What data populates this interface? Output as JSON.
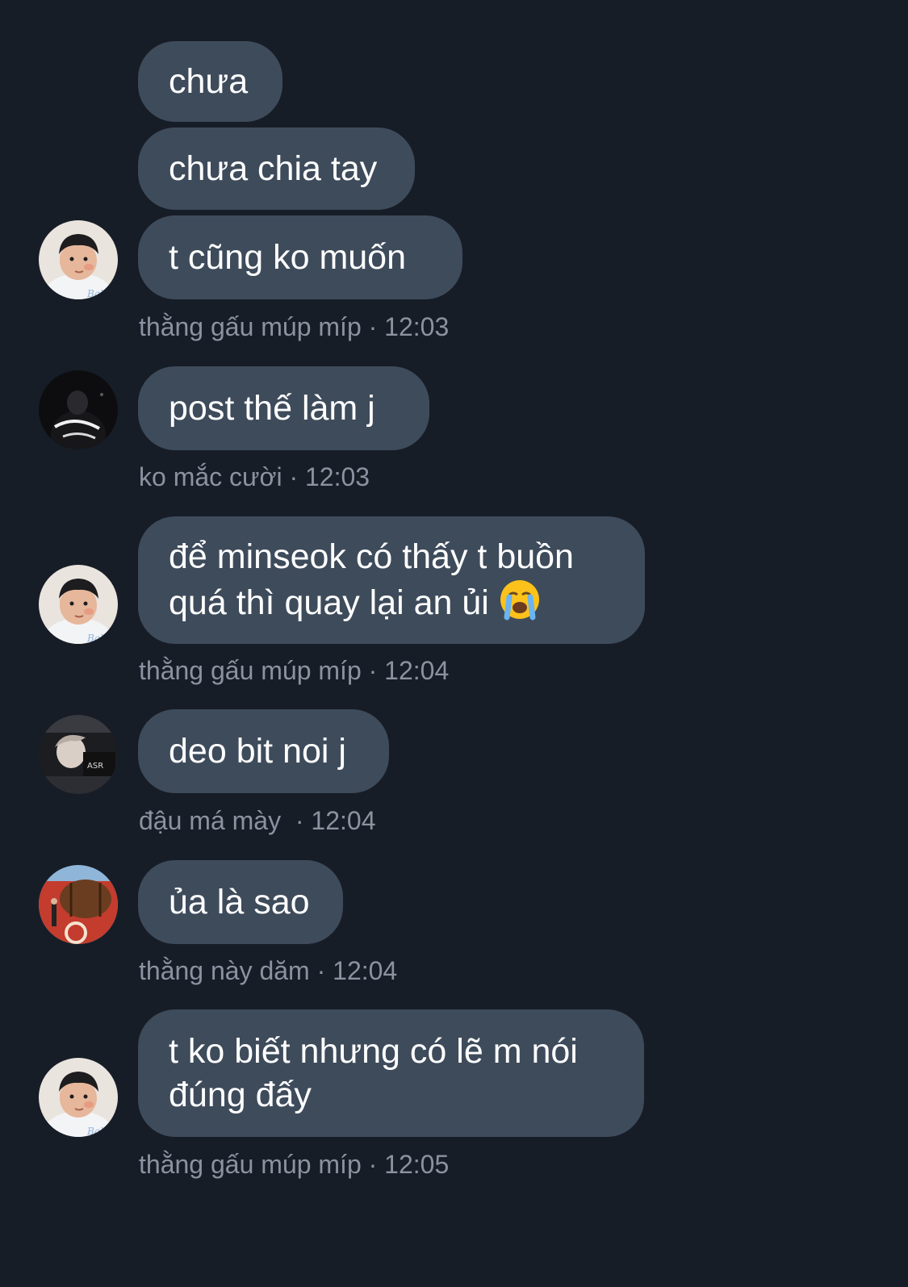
{
  "messages": [
    {
      "text": "chưa"
    },
    {
      "text": "chưa chia tay"
    },
    {
      "text": "t cũng ko muốn"
    },
    {
      "meta": "thằng gấu múp míp · 12:03"
    },
    {
      "text": "post thế làm j"
    },
    {
      "meta": "ko mắc cười · 12:03"
    },
    {
      "text": "để minseok có thấy t buồn quá thì quay lại an ủi"
    },
    {
      "meta": "thằng gấu múp míp · 12:04"
    },
    {
      "text": "deo bit noi j"
    },
    {
      "meta": "đậu má mày  · 12:04"
    },
    {
      "text": "ủa là sao"
    },
    {
      "meta": "thằng này dăm · 12:04"
    },
    {
      "text": "t ko biết nhưng có lẽ m nói đúng đấy"
    },
    {
      "meta": "thằng gấu múp míp · 12:05"
    }
  ],
  "icons": {
    "crying_emoji": "loudly-crying-face-icon"
  },
  "colors": {
    "background": "#171d27",
    "bubble": "#3e4b5b",
    "text": "#ffffff",
    "meta": "#8a93a0"
  }
}
